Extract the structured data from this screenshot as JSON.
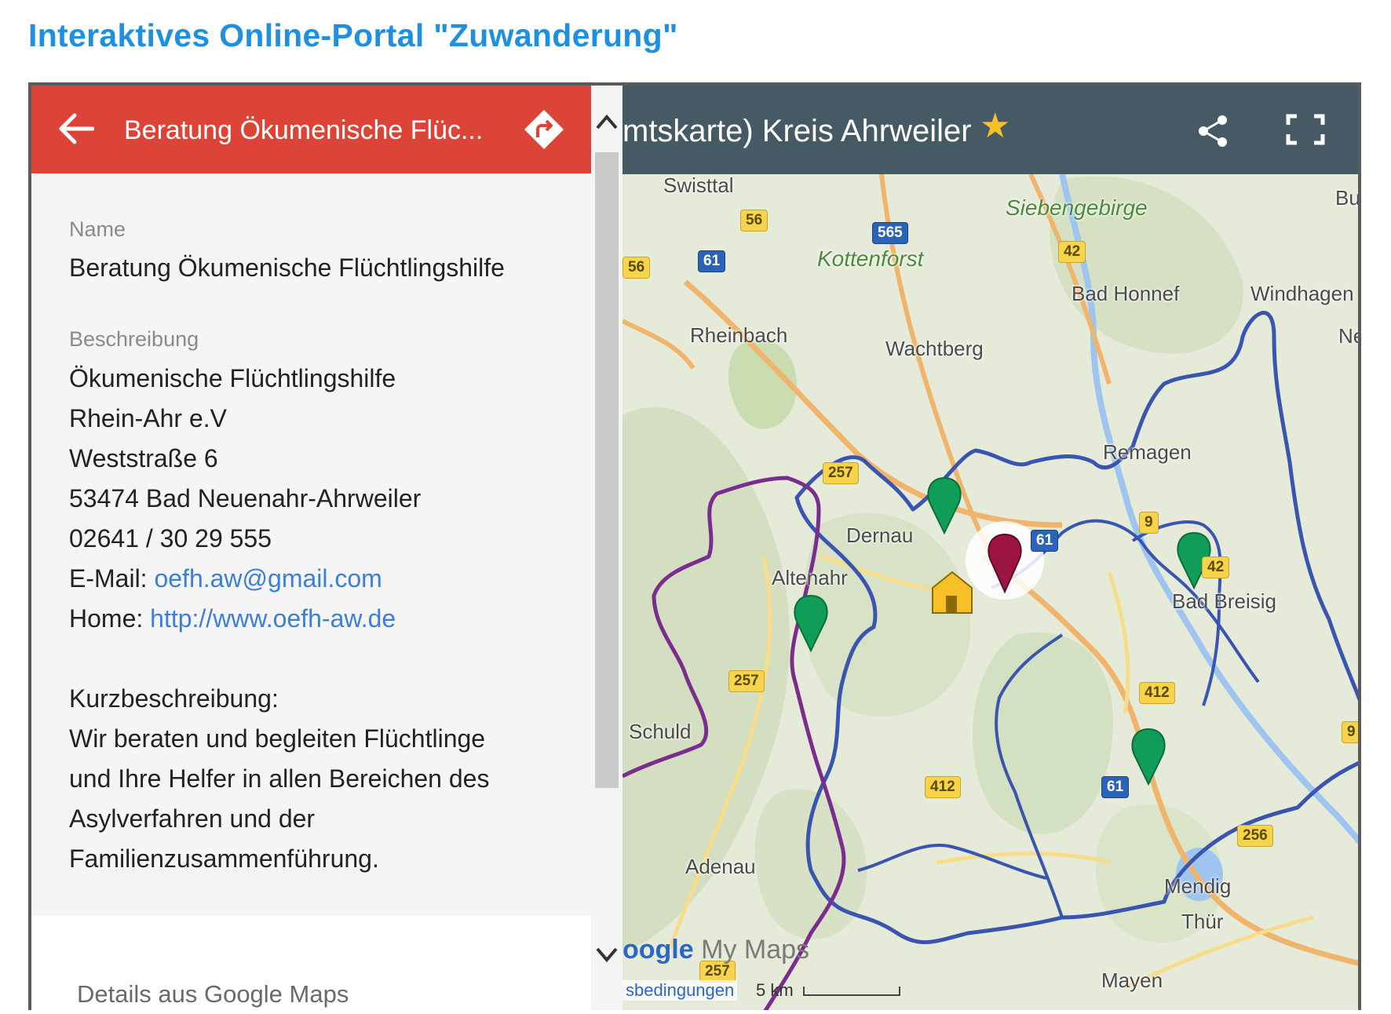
{
  "page": {
    "title": "Interaktives Online-Portal \"Zuwanderung\""
  },
  "panel": {
    "header_title": "Beratung Ökumenische Flüc...",
    "name_label": "Name",
    "name_value": "Beratung Ökumenische Flüchtlingshilfe",
    "description_label": "Beschreibung",
    "description_lines": [
      "Ökumenische Flüchtlingshilfe",
      "Rhein-Ahr e.V",
      "Weststraße 6",
      "53474 Bad Neuenahr-Ahrweiler",
      "02641 / 30 29 555"
    ],
    "email_prefix": "E-Mail: ",
    "email": "oefh.aw@gmail.com",
    "home_prefix": "Home: ",
    "home_url": "http://www.oefh-aw.de",
    "short_desc_label": "Kurzbeschreibung:",
    "short_desc_lines": [
      "Wir beraten und begleiten Flüchtlinge",
      "und Ihre Helfer in allen Bereichen des",
      "Asylverfahren und der",
      "Familienzusammenführung."
    ],
    "details_link": "Details aus Google Maps"
  },
  "map": {
    "title": "mtskarte) Kreis Ahrweiler",
    "brand_google": "oogle",
    "brand_mymaps": " My Maps",
    "terms": "sbedingungen",
    "scale": "5 km",
    "places": {
      "swisttal": "Swisttal",
      "siebengebirge": "Siebengebirge",
      "kottenforst": "Kottenforst",
      "bad_honnef": "Bad Honnef",
      "windhagen": "Windhagen",
      "rheinbach": "Rheinbach",
      "wachtberg": "Wachtberg",
      "remagen": "Remagen",
      "dernau": "Dernau",
      "altenahr": "Altenahr",
      "bad_breisig": "Bad Breisig",
      "schuld": "Schuld",
      "adenau": "Adenau",
      "mendig": "Mendig",
      "thur": "Thür",
      "mayen": "Mayen",
      "buc": "Buc",
      "ne": "Ne"
    },
    "roads": {
      "r56": "56",
      "r565": "565",
      "r61a": "61",
      "r56b": "56",
      "r42a": "42",
      "r257a": "257",
      "r61b": "61",
      "r9": "9",
      "r42b": "42",
      "r257b": "257",
      "r412a": "412",
      "r412b": "412",
      "r61c": "61",
      "r256": "256",
      "r9b": "9",
      "r257c": "257"
    },
    "colors": {
      "header": "#455a64",
      "star": "#f6c026",
      "boundary_blue": "#3a55b0",
      "boundary_purple": "#7b2d8e",
      "pin_green": "#0f9d58",
      "pin_red": "#9c1443"
    }
  }
}
